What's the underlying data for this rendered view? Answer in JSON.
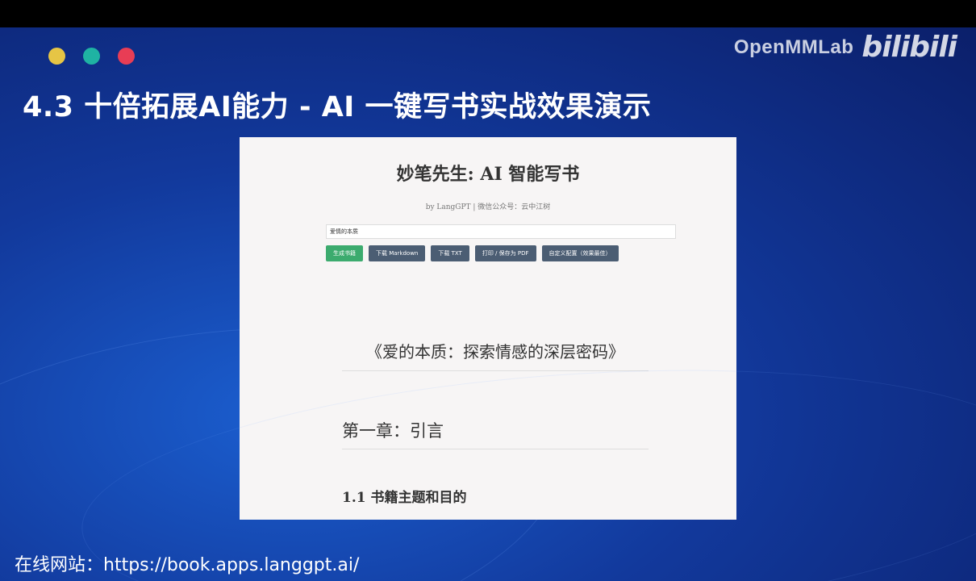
{
  "brand": {
    "name": "OpenMMLab",
    "platform": "bilibili"
  },
  "slide": {
    "title": "4.3 十倍拓展AI能力 - AI 一键写书实战效果演示"
  },
  "app": {
    "title": "妙笔先生: AI 智能写书",
    "subtitle": "by LangGPT | 微信公众号：云中江树",
    "input_value": "爱情的本质",
    "buttons": [
      {
        "label": "生成书籍"
      },
      {
        "label": "下载 Markdown"
      },
      {
        "label": "下载 TXT"
      },
      {
        "label": "打印 / 保存为 PDF"
      },
      {
        "label": "自定义配置（效果最佳）"
      }
    ]
  },
  "book": {
    "title": "《爱的本质：探索情感的深层密码》",
    "chapter": "第一章：引言",
    "section": "1.1 书籍主题和目的"
  },
  "footer": {
    "url_text": "在线网站：https://book.apps.langgpt.ai/"
  },
  "colors": {
    "primary_button": "#3cab6e",
    "secondary_button": "#4b5d73",
    "slide_bg": "#12399c"
  }
}
